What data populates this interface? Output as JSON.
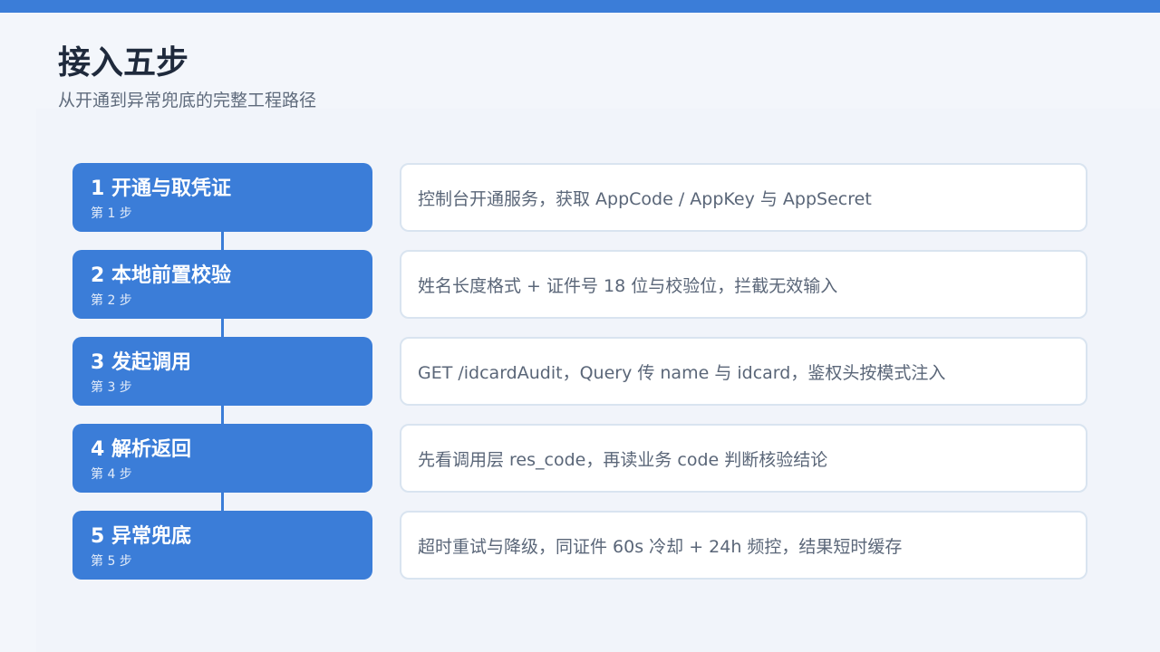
{
  "header": {
    "title": "接入五步",
    "subtitle": "从开通到异常兜底的完整工程路径"
  },
  "steps": [
    {
      "title": "1 开通与取凭证",
      "sub": "第 1 步",
      "desc": "控制台开通服务，获取 AppCode / AppKey 与 AppSecret"
    },
    {
      "title": "2 本地前置校验",
      "sub": "第 2 步",
      "desc": "姓名长度格式 + 证件号 18 位与校验位，拦截无效输入"
    },
    {
      "title": "3 发起调用",
      "sub": "第 3 步",
      "desc": "GET /idcardAudit，Query 传 name 与 idcard，鉴权头按模式注入"
    },
    {
      "title": "4 解析返回",
      "sub": "第 4 步",
      "desc": "先看调用层 res_code，再读业务 code 判断核验结论"
    },
    {
      "title": "5 异常兜底",
      "sub": "第 5 步",
      "desc": "超时重试与降级，同证件 60s 冷却 + 24h 频控，结果短时缓存"
    }
  ],
  "colors": {
    "accent": "#3b7dd8",
    "background": "#f3f6fb",
    "card_border": "#d9e4f0",
    "title_text": "#1f2a3c",
    "body_text": "#5a6678"
  }
}
